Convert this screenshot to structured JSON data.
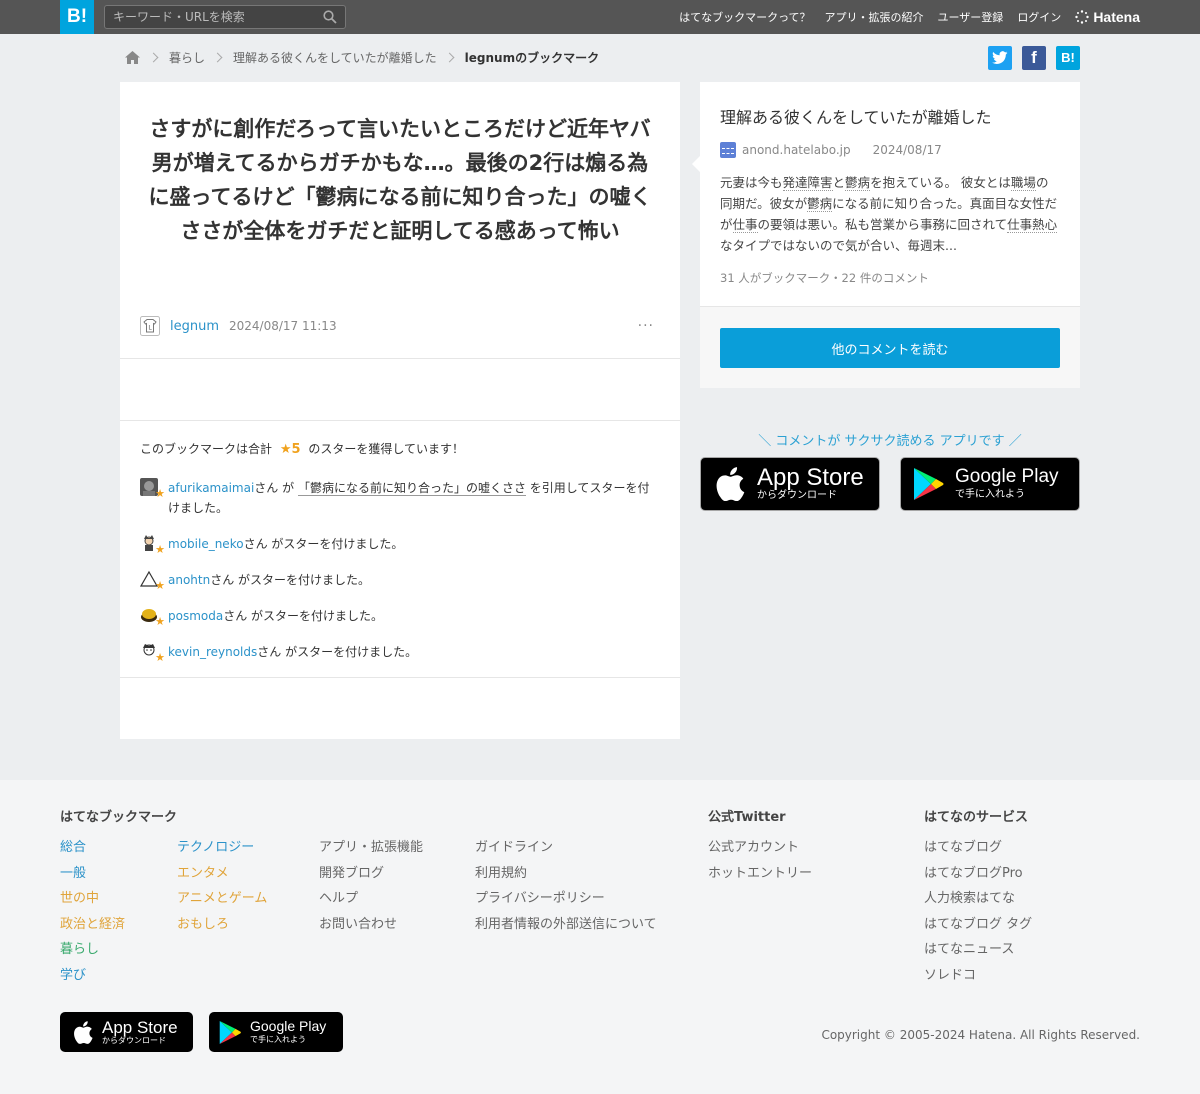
{
  "header": {
    "logo": "B!",
    "search_placeholder": "キーワード・URLを検索",
    "nav": [
      "はてなブックマークって？",
      "アプリ・拡張の紹介",
      "ユーザー登録",
      "ログイン"
    ],
    "brand": "Hatena"
  },
  "breadcrumb": {
    "items": [
      "暮らし",
      "理解ある彼くんをしていたが離婚した",
      "legnumのブックマーク"
    ]
  },
  "share": {
    "twitter": "t",
    "facebook": "f",
    "hatena": "B!"
  },
  "bookmark": {
    "comment": "さすがに創作だろって言いたいところだけど近年ヤバ男が増えてるからガチかもな…。最後の2行は煽る為に盛ってるけど「鬱病になる前に知り合った」の嘘くささが全体をガチだと証明してる感あって怖い",
    "user": "legnum",
    "datetime": "2024/08/17 11:13",
    "more": "···"
  },
  "stars": {
    "head_prefix": "このブックマークは合計",
    "count": "★5",
    "head_suffix": "のスターを獲得しています！",
    "entries": [
      {
        "user": "afurikamaimai",
        "pre": "さん が",
        "quote": "「鬱病になる前に知り合った」の嘘くささ",
        "post": "を引用してスターを付けました。"
      },
      {
        "user": "mobile_neko",
        "post": "さん がスターを付けました。"
      },
      {
        "user": "anohtn",
        "post": "さん がスターを付けました。"
      },
      {
        "user": "posmoda",
        "post": "さん がスターを付けました。"
      },
      {
        "user": "kevin_reynolds",
        "post": "さん がスターを付けました。"
      }
    ]
  },
  "entry": {
    "title": "理解ある彼くんをしていたが離婚した",
    "domain": "anond.hatelabo.jp",
    "date": "2024/08/17",
    "summary": [
      "元妻は今も",
      "発達障害",
      "と",
      "鬱病",
      "を抱えている。 彼女とは",
      "職場",
      "の同期だ。彼女が",
      "鬱病",
      "になる前に知り合った。真面目な女性だが",
      "仕事",
      "の要領は悪い。私も営業から事務に回されて",
      "仕事熱心",
      "なタイプではないので気が合い、毎週末..."
    ],
    "meta": "31 人がブックマーク・22 件のコメント",
    "button": "他のコメントを読む"
  },
  "promo": {
    "text": "＼ コメントが サクサク読める アプリです ／",
    "appstore_big": "App Store",
    "appstore_small": "からダウンロード",
    "googleplay_big": "Google Play",
    "googleplay_small": "で手に入れよう"
  },
  "footer": {
    "bookmark_head": "はてなブックマーク",
    "col1": [
      "総合",
      "一般",
      "世の中",
      "政治と経済",
      "暮らし",
      "学び"
    ],
    "col2": [
      "テクノロジー",
      "エンタメ",
      "アニメとゲーム",
      "おもしろ"
    ],
    "col3": [
      "アプリ・拡張機能",
      "開発ブログ",
      "ヘルプ",
      "お問い合わせ"
    ],
    "col4": [
      "ガイドライン",
      "利用規約",
      "プライバシーポリシー",
      "利用者情報の外部送信について"
    ],
    "twitter_head": "公式Twitter",
    "col5": [
      "公式アカウント",
      "ホットエントリー"
    ],
    "services_head": "はてなのサービス",
    "col6": [
      "はてなブログ",
      "はてなブログPro",
      "人力検索はてな",
      "はてなブログ タグ",
      "はてなニュース",
      "ソレドコ"
    ],
    "copyright": "Copyright © 2005-2024 Hatena. All Rights Reserved."
  },
  "colors": {
    "accent": "#00a4de",
    "link": "#2b92c9",
    "star": "#f0a21e",
    "button": "#0a9ed9"
  }
}
